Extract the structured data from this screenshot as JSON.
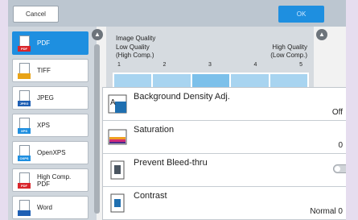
{
  "topbar": {
    "cancel_label": "Cancel",
    "ok_label": "OK"
  },
  "formats": [
    {
      "label": "PDF",
      "tag": "PDF",
      "tag_color": "#d9262c",
      "selected": true
    },
    {
      "label": "TIFF",
      "tag": "",
      "tag_color": "#e8a317",
      "selected": false
    },
    {
      "label": "JPEG",
      "tag": "JPEG",
      "tag_color": "#1e5fb4",
      "selected": false
    },
    {
      "label": "XPS",
      "tag": "XPS",
      "tag_color": "#1e8fe0",
      "selected": false
    },
    {
      "label": "OpenXPS",
      "tag": "OXPS",
      "tag_color": "#1e8fe0",
      "selected": false
    },
    {
      "label": "High Comp. PDF",
      "tag": "PDF",
      "tag_color": "#d9262c",
      "selected": false
    },
    {
      "label": "Word",
      "tag": "",
      "tag_color": "#1e5fb4",
      "selected": false
    }
  ],
  "quality": {
    "title": "Image Quality",
    "low_line1": "Low Quality",
    "low_line2": "(High Comp.)",
    "high_line1": "High Quality",
    "high_line2": "(Low Comp.)",
    "levels": [
      "1",
      "2",
      "3",
      "4",
      "5"
    ]
  },
  "settings": [
    {
      "label": "Background Density Adj.",
      "value": "Off",
      "icon": "background-density-icon"
    },
    {
      "label": "Saturation",
      "value": "0",
      "icon": "saturation-icon"
    },
    {
      "label": "Prevent Bleed-thru",
      "value": "",
      "icon": "prevent-bleed-icon"
    },
    {
      "label": "Contrast",
      "value": "Normal 0",
      "icon": "contrast-icon"
    }
  ]
}
